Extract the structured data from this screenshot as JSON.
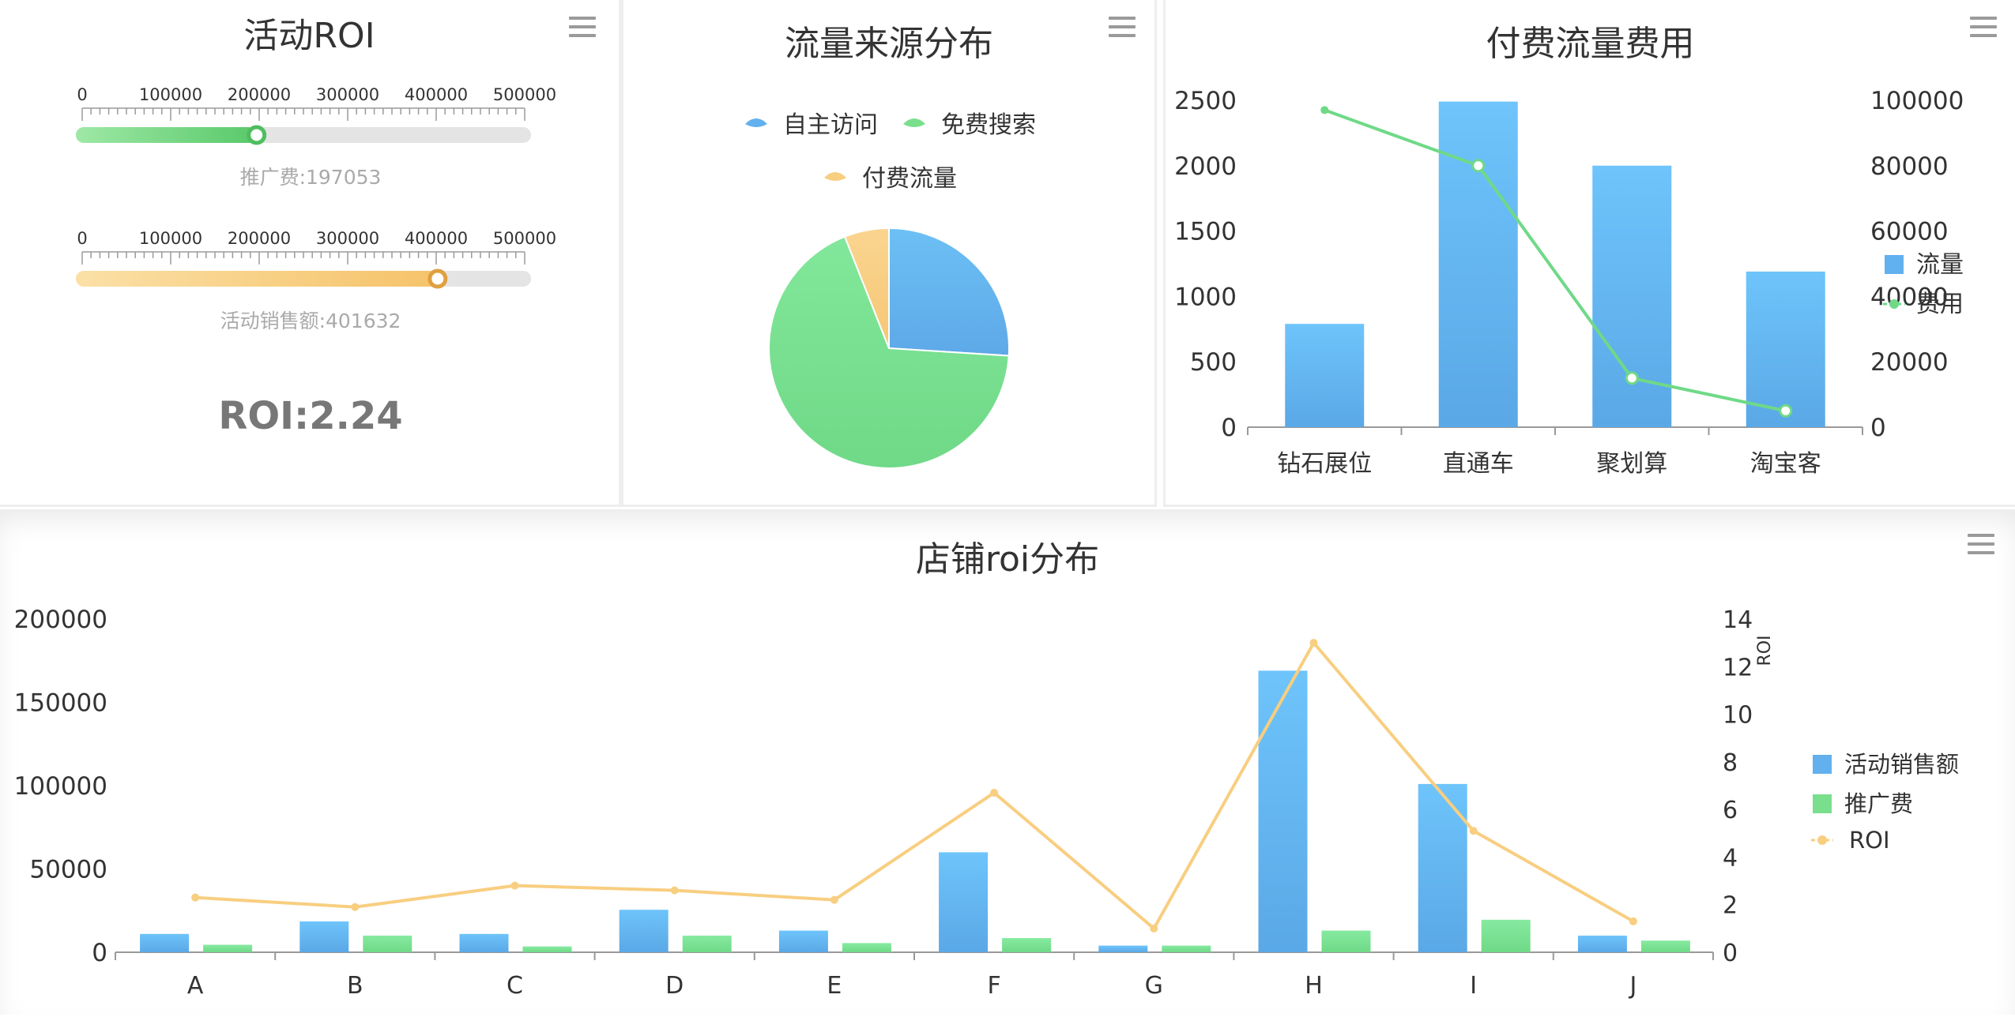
{
  "panels": {
    "roi": {
      "title": "活动ROI",
      "sliders": [
        {
          "ticks": [
            "0",
            "100000",
            "200000",
            "300000",
            "400000",
            "500000"
          ],
          "max": 500000,
          "value": 197053,
          "label": "推广费:197053",
          "color_start": "#9ee8a6",
          "color_end": "#59c96a",
          "knob": "#4fbd60"
        },
        {
          "ticks": [
            "0",
            "100000",
            "200000",
            "300000",
            "400000",
            "500000"
          ],
          "max": 500000,
          "value": 401632,
          "label": "活动销售额:401632",
          "color_start": "#fbe0a6",
          "color_end": "#f5c36a",
          "knob": "#e0a040"
        }
      ],
      "roi_text": "ROI:2.24"
    },
    "source": {
      "title": "流量来源分布"
    },
    "paid": {
      "title": "付费流量费用"
    },
    "store": {
      "title": "店铺roi分布"
    }
  },
  "colors": {
    "blue": "#62b0ee",
    "green": "#79df8c",
    "orange": "#f8ce80",
    "axis": "#999999"
  },
  "chart_data": [
    {
      "type": "pie",
      "title": "流量来源分布",
      "legend": [
        "自主访问",
        "免费搜索",
        "付费流量"
      ],
      "slices": [
        {
          "name": "自主访问",
          "value": 26
        },
        {
          "name": "免费搜索",
          "value": 68
        },
        {
          "name": "付费流量",
          "value": 6
        }
      ]
    },
    {
      "type": "bar",
      "title": "付费流量费用",
      "categories": [
        "钻石展位",
        "直通车",
        "聚划算",
        "淘宝客"
      ],
      "y_ticks": [
        "0",
        "500",
        "1000",
        "1500",
        "2000",
        "2500"
      ],
      "y2_ticks": [
        "0",
        "20000",
        "40000",
        "60000",
        "80000",
        "100000"
      ],
      "ylim": [
        0,
        2500
      ],
      "y2lim": [
        0,
        100000
      ],
      "series": [
        {
          "name": "流量",
          "type": "bar",
          "values": [
            790,
            2490,
            2000,
            1190
          ]
        },
        {
          "name": "费用",
          "type": "line",
          "values": [
            97000,
            80000,
            15000,
            5000
          ]
        }
      ],
      "legend_position": "right"
    },
    {
      "type": "bar",
      "title": "店铺roi分布",
      "categories": [
        "A",
        "B",
        "C",
        "D",
        "E",
        "F",
        "G",
        "H",
        "I",
        "J"
      ],
      "y_ticks": [
        "0",
        "50000",
        "100000",
        "150000",
        "200000"
      ],
      "y2_ticks": [
        "0",
        "2",
        "4",
        "6",
        "8",
        "10",
        "12",
        "14"
      ],
      "y2label": "ROI",
      "ylim": [
        0,
        200000
      ],
      "y2lim": [
        0,
        14
      ],
      "series": [
        {
          "name": "活动销售额",
          "type": "bar",
          "values": [
            11000,
            18500,
            11000,
            25500,
            13000,
            60000,
            4000,
            169000,
            101000,
            10000
          ]
        },
        {
          "name": "推广费",
          "type": "bar",
          "values": [
            4500,
            10000,
            3500,
            10000,
            5500,
            8500,
            4000,
            13000,
            19500,
            7000
          ]
        },
        {
          "name": "ROI",
          "type": "line",
          "values": [
            2.3,
            1.9,
            2.8,
            2.6,
            2.2,
            6.7,
            1.0,
            13.0,
            5.1,
            1.3
          ]
        }
      ],
      "legend_position": "right"
    }
  ]
}
